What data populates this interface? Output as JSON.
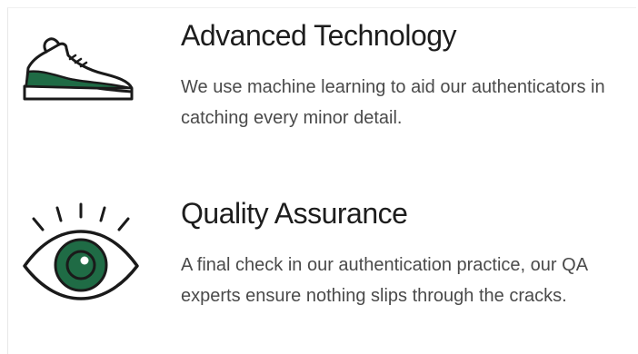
{
  "features": [
    {
      "icon": "sneaker-icon",
      "title": "Advanced Technology",
      "description": "We use machine learning to aid our authenticators in catching every minor detail."
    },
    {
      "icon": "eye-icon",
      "title": "Quality Assurance",
      "description": "A final check in our authentication practice, our QA experts ensure nothing slips through the cracks."
    }
  ],
  "colors": {
    "accent": "#1f6b45",
    "ink": "#1a1a1a",
    "body_text": "#4a4a4a",
    "background": "#ffffff"
  }
}
